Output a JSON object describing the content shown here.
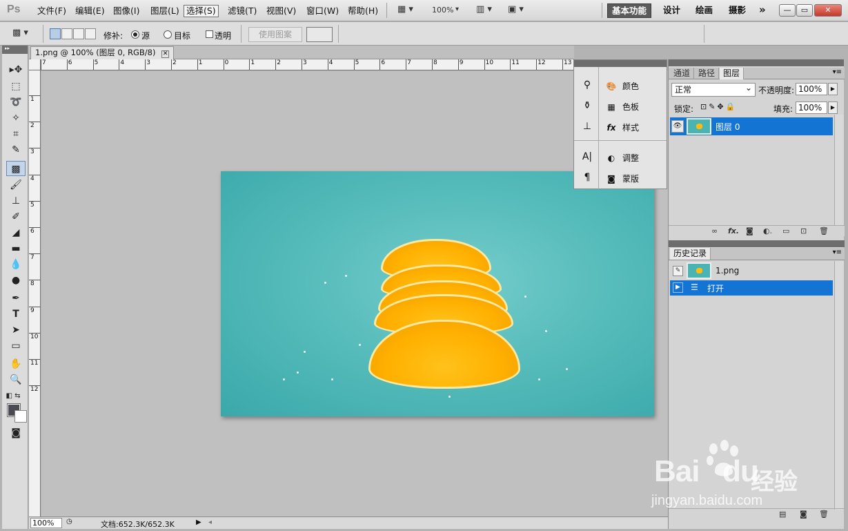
{
  "app": {
    "logo": "Ps"
  },
  "menu": {
    "items": [
      "文件(F)",
      "编辑(E)",
      "图像(I)",
      "图层(L)",
      "选择(S)",
      "滤镜(T)",
      "视图(V)",
      "窗口(W)",
      "帮助(H)"
    ],
    "active_index": 4,
    "zoom": "100%",
    "workspaces": [
      "基本功能",
      "设计",
      "绘画",
      "摄影"
    ],
    "more": "»",
    "window_controls": {
      "minimize": "—",
      "restore": "▭",
      "close": "✕"
    }
  },
  "options": {
    "mode_label": "修补:",
    "radio_source": "源",
    "radio_target": "目标",
    "checkbox_transparent": "透明",
    "use_pattern_button": "使用图案"
  },
  "document": {
    "tab_title": "1.png @ 100% (图层 0, RGB/8)",
    "tab_close": "✕",
    "hruler_labels": [
      "7",
      "6",
      "5",
      "4",
      "3",
      "2",
      "1",
      "0",
      "1",
      "2",
      "3",
      "4",
      "5",
      "6",
      "7",
      "8",
      "9",
      "10",
      "11",
      "12",
      "13"
    ],
    "vruler_labels": [
      "1",
      "2",
      "3",
      "4",
      "5",
      "6",
      "7",
      "8",
      "9",
      "10",
      "11",
      "12"
    ]
  },
  "status": {
    "zoom": "100%",
    "doc_info": "文档:652.3K/652.3K"
  },
  "icon_panel": {
    "rows": [
      {
        "label": "颜色",
        "glyph": "🎨"
      },
      {
        "label": "色板",
        "glyph": "▦"
      },
      {
        "label": "样式",
        "glyph": "fx"
      },
      {
        "label": "调整",
        "glyph": "◐"
      },
      {
        "label": "蒙版",
        "glyph": "◙"
      }
    ],
    "left_icons": [
      "⚲",
      "⚱",
      "⊥",
      "A|",
      "¶"
    ]
  },
  "layers_panel": {
    "tabs": [
      "通道",
      "路径",
      "图层"
    ],
    "active_tab": "图层",
    "blend_mode": "正常",
    "opacity_label": "不透明度:",
    "opacity_value": "100%",
    "lock_label": "锁定:",
    "fill_label": "填充:",
    "fill_value": "100%",
    "layers": [
      {
        "name": "图层 0",
        "selected": true
      }
    ],
    "footer_icons": [
      "∞",
      "fx.",
      "◙",
      "◐.",
      "▭",
      "⊡",
      "🗑"
    ]
  },
  "history_panel": {
    "title": "历史记录",
    "snapshot": "1.png",
    "items": [
      {
        "label": "打开",
        "selected": true
      }
    ]
  },
  "watermark": {
    "brand_left": "Bai",
    "brand_right": "du",
    "product": "经验",
    "url": "jingyan.baidu.com"
  }
}
